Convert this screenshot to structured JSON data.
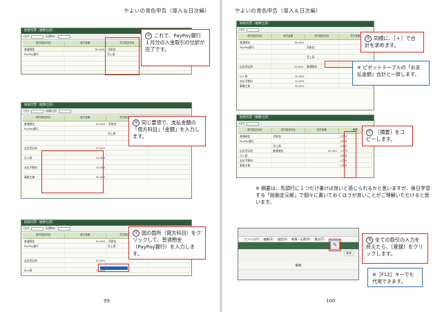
{
  "book": {
    "header_left": "やよいの青色申告（導入＆日次編）",
    "header_right": "やよいの青色申告（導入＆日次編）",
    "page_left": "99",
    "page_right": "100"
  },
  "shots": {
    "s1_title": "振替伝票（複数仕訳）",
    "s2_title": "振替伝票（複数仕訳）",
    "s3_title": "振替伝票（複数仕訳）",
    "s4_title": "振替伝票（複数仕訳）",
    "s5_title": "振替伝票（複数仕訳）",
    "hdr_debit_acct": "借方勘定科目",
    "hdr_debit_sub": "借方補助科目",
    "hdr_debit_amt": "借方金額",
    "hdr_credit_acct": "貸方勘定科目",
    "hdr_credit_sub": "貸方補助科目",
    "hdr_credit_amt": "貸方金額",
    "hdr_tax": "税",
    "acct_futsu": "普通預金",
    "sub_paypay": "PayPay銀行",
    "acct_urikake": "売掛金",
    "acct_uriage": "売上高",
    "acct_kokoku": "広告宣伝費",
    "acct_shiire": "仕入高",
    "acct_shiharai": "支払手数料",
    "acct_jigyo": "事業主貸",
    "amt_50000": "50,000",
    "amt_10000": "10,000",
    "amt_15000": "15,000",
    "amt_15000b": "15,000",
    "amt_10000b": "10,000",
    "amt_30000": "30,000",
    "sum_label": "普通預金",
    "sum_value": "50,000",
    "memo_col": "摘要",
    "memo_val": "1月分",
    "toolbar_date": "日付",
    "toolbar_no": "伝票No.",
    "toolbar_kessan": "決算仕訳",
    "register_label": "登録",
    "menu_items": [
      "ファイル(F)",
      "編集(E)",
      "設定(S)",
      "帳簿・伝票(D)",
      "集計(T)"
    ],
    "band_text": "摘要"
  },
  "callouts": {
    "c13_num": "⑬",
    "c13_text": "これで、PayPay銀行１月分の入金取引の仕訳が完了です。",
    "c14_num": "⑭",
    "c14_text": "同じ要領で、支払金額の「借方科目」「金額」を入力します。",
    "c15_num": "⑮",
    "c15_text": "図の箇所（貸方科目）をクリックして、普通預金（PayPay銀行）を入力します。",
    "c16_num": "⑯",
    "c16_text": "同様に、［＋］で合計を求めます。",
    "c17_num": "⑰",
    "c17_text": "［摘要］をコピーします。",
    "c18_num": "⑱",
    "c18_text": "全ての取引の入力を終えたら、［登録］をクリックします。"
  },
  "notes": {
    "note_pivot": "※ ピボットテーブルの「お支払金額」合計と一致します。",
    "note_memo": "※ 摘要は、先頭行に１つだけ書けば良いと感じられるかと思いますが、後日学習する「総勘定元帳」で個々に書いておくほうが良いことがご理解いただけると思います。",
    "note_f12": "※［F12］キーでも代用できます。"
  },
  "colors": {
    "accent_red": "#d9281f",
    "note_blue": "#2b6fb8",
    "app_green": "#2f5a3c",
    "header_green": "#d7e6c4",
    "select_blue": "#1f5fc6"
  }
}
